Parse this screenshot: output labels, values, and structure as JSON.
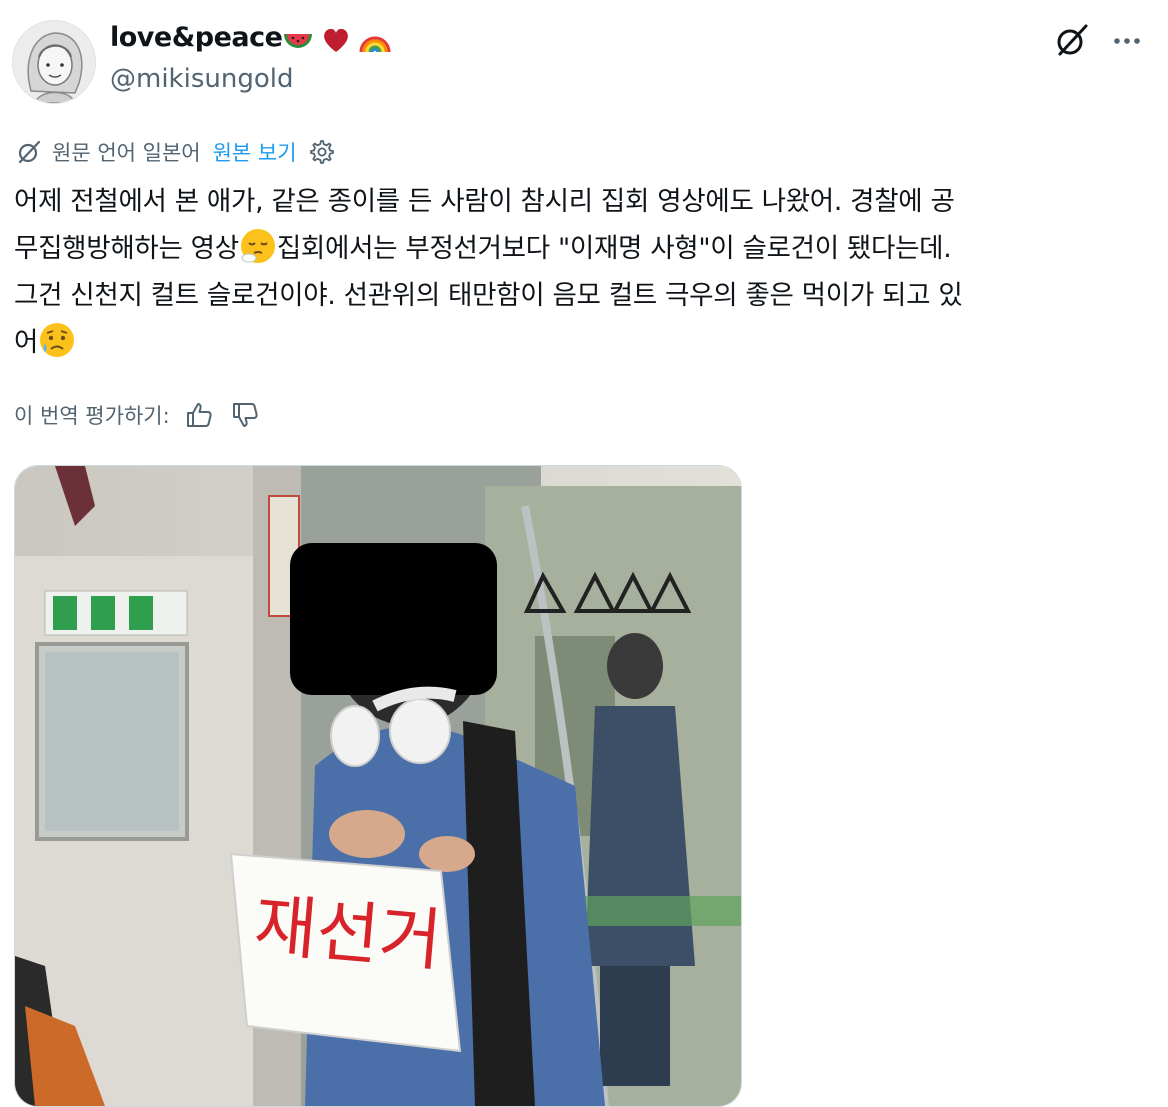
{
  "author": {
    "display_name": "love&peace",
    "name_emojis": [
      "watermelon-emoji",
      "red-heart-emoji",
      "rainbow-emoji"
    ],
    "handle": "@mikisungold",
    "avatar": "illustrated-portrait-avatar"
  },
  "header_icons": [
    "grok-icon",
    "more-icon"
  ],
  "translation": {
    "icon": "translate-icon",
    "source_language_text": "원문 언어 일본어",
    "show_original_label": "원본 보기",
    "settings_icon": "gear-icon"
  },
  "tweet": {
    "line1": "어제 전철에서 본 애가, 같은 종이를 든 사람이 참시리 집회 영상에도 나왔어. 경찰에 공",
    "line2a": "무집행방해하는 영상",
    "line2b": "집회에서는 부정선거보다 \"이재명 사형\"이 슬로건이 됐다는데.",
    "line3": "그건 신천지 컬트 슬로건이야. 선관위의 태만함이 음모 컬트 극우의 좋은 먹이가 되고 있",
    "line4": "어",
    "emojis": [
      "face-exhaling-emoji",
      "sad-but-relieved-face-emoji"
    ]
  },
  "rate_translation": {
    "label": "이 번역 평가하기:",
    "buttons": [
      "thumbs-up-icon",
      "thumbs-down-icon"
    ]
  },
  "media": {
    "sign_text": "재선거",
    "description_icons": [
      "subway-car-photo"
    ]
  },
  "colors": {
    "text": "#0f1419",
    "secondary": "#536471",
    "link": "#1d9bf0",
    "border": "#cfd9de",
    "sign_red": "#d8232a"
  }
}
